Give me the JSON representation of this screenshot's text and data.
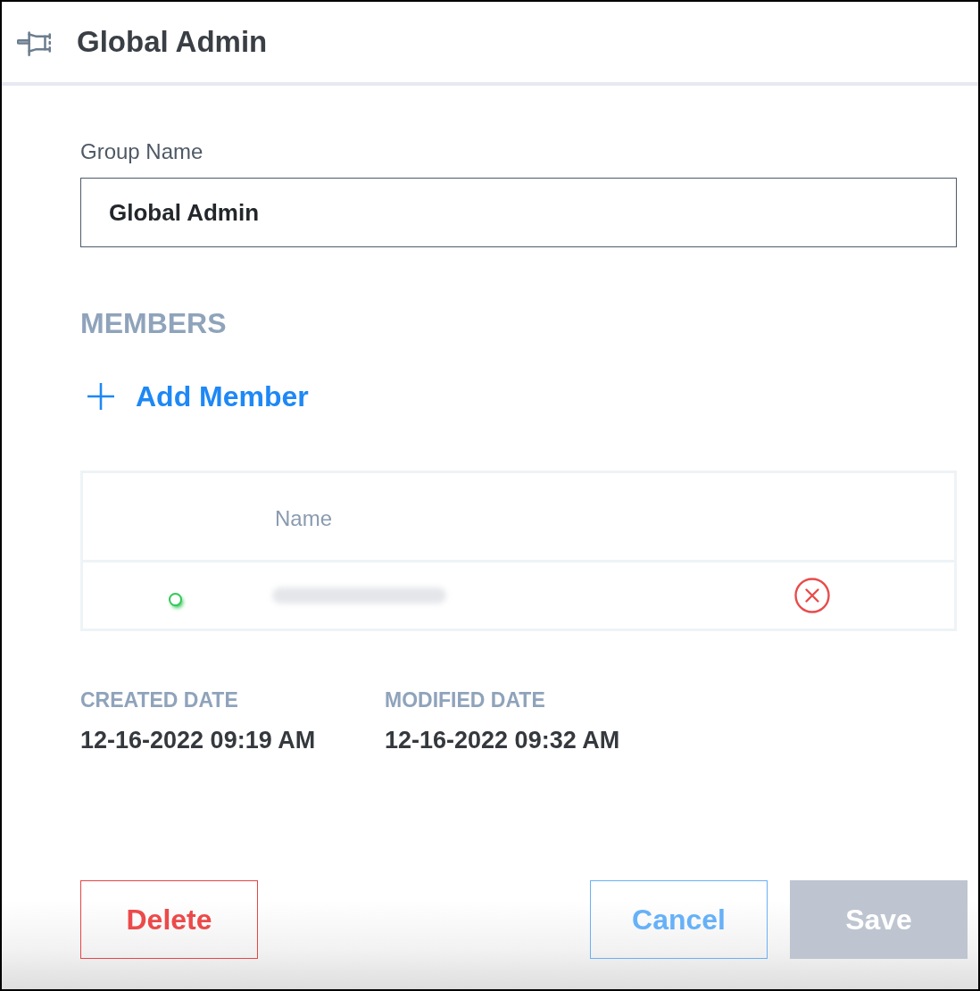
{
  "header": {
    "title": "Global Admin"
  },
  "group_name": {
    "label": "Group Name",
    "value": "Global Admin"
  },
  "members": {
    "heading": "MEMBERS",
    "add_button": {
      "label": "Add Member"
    },
    "table": {
      "columns": [
        "Name"
      ],
      "rows": [
        {
          "color": "#34c759"
        }
      ]
    }
  },
  "dates": [
    {
      "label": "CREATED DATE",
      "value": "12-16-2022 09:19 AM"
    },
    {
      "label": "MODIFIED DATE",
      "value": "12-16-2022 09:32 AM"
    }
  ],
  "buttons": [
    {
      "label": "Delete",
      "kind": "danger",
      "disabled": false
    },
    {
      "label": "Cancel",
      "kind": "secondary",
      "disabled": false
    },
    {
      "label": "Save",
      "kind": "primary",
      "disabled": true
    }
  ]
}
